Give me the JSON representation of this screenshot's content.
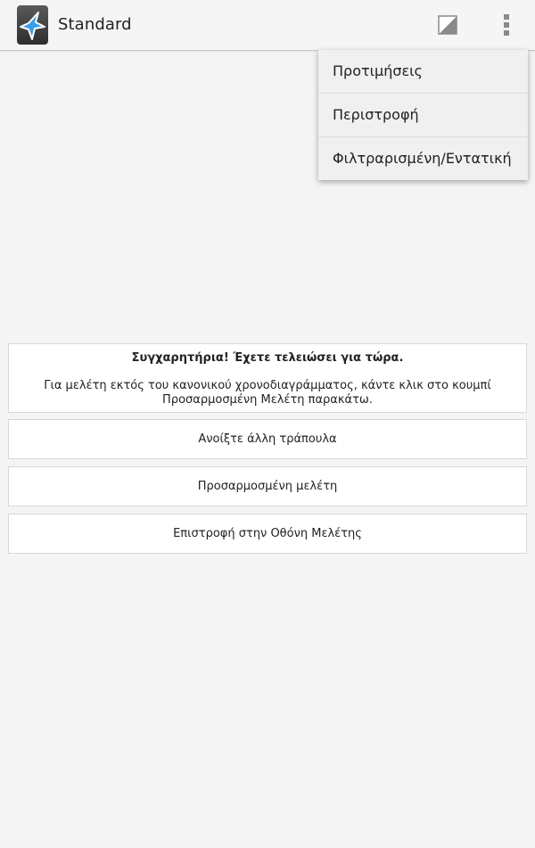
{
  "action_bar": {
    "title": "Standard",
    "app_icon": "anki-star-icon",
    "edit_icon": "edit-card-icon",
    "overflow_icon": "overflow-menu-icon"
  },
  "menu": {
    "items": [
      {
        "label": "Προτιμήσεις"
      },
      {
        "label": "Περιστροφή"
      },
      {
        "label": "Φιλτραρισμένη/Εντατική"
      }
    ]
  },
  "congrats": {
    "title": "Συγχαρητήρια! Έχετε τελειώσει για τώρα.",
    "body": "Για μελέτη εκτός του κανονικού χρονοδιαγράμματος, κάντε κλικ στο κουμπί Προσαρμοσμένη Μελέτη παρακάτω."
  },
  "buttons": {
    "open_deck": "Ανοίξτε άλλη τράπουλα",
    "custom_study": "Προσαρμοσμένη μελέτη",
    "back_to_overview": "Επιστροφή στην Οθόνη Μελέτης"
  },
  "colors": {
    "background": "#f4f4f4",
    "accent_star": "#3a9ee8"
  }
}
